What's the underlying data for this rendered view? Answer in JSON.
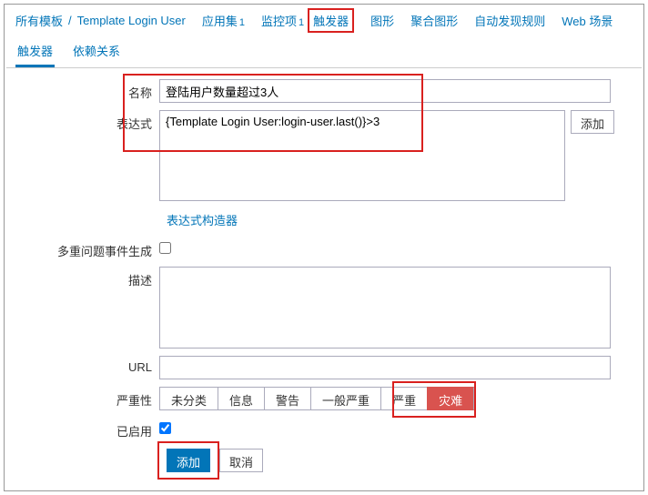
{
  "breadcrumb": {
    "root": "所有模板",
    "template": "Template Login User"
  },
  "nav": {
    "apps": "应用集",
    "apps_count": "1",
    "items": "监控项",
    "items_count": "1",
    "triggers": "触发器",
    "graphs": "图形",
    "screens": "聚合图形",
    "discovery": "自动发现规则",
    "web": "Web 场景"
  },
  "tabs": {
    "trigger": "触发器",
    "dependencies": "依赖关系"
  },
  "form": {
    "name_label": "名称",
    "name_value": "登陆用户数量超过3人",
    "expression_label": "表达式",
    "expression_value": "{Template Login User:login-user.last()}>3",
    "add_btn": "添加",
    "expr_builder": "表达式构造器",
    "multiple_label": "多重问题事件生成",
    "description_label": "描述",
    "url_label": "URL",
    "url_value": "",
    "severity_label": "严重性",
    "enabled_label": "已启用"
  },
  "severity": {
    "not_classified": "未分类",
    "information": "信息",
    "warning": "警告",
    "average": "一般严重",
    "high": "严重",
    "disaster": "灾难"
  },
  "actions": {
    "submit": "添加",
    "cancel": "取消"
  }
}
